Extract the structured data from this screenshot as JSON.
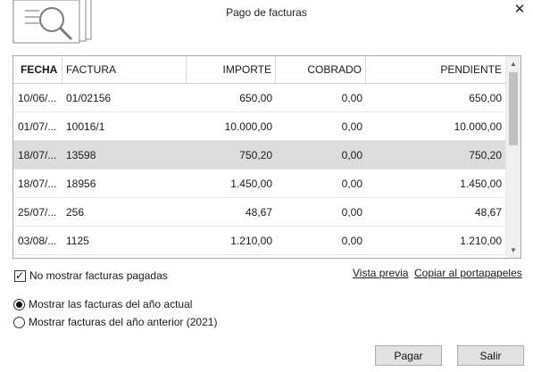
{
  "window": {
    "title": "Pago de facturas"
  },
  "table": {
    "columns": [
      "FECHA",
      "FACTURA",
      "IMPORTE",
      "COBRADO",
      "PENDIENTE"
    ],
    "rows": [
      [
        "10/06/...",
        "01/02156",
        "650,00",
        "0,00",
        "650,00"
      ],
      [
        "01/07/...",
        "10016/1",
        "10.000,00",
        "0,00",
        "10.000,00"
      ],
      [
        "18/07/...",
        "13598",
        "750,20",
        "0,00",
        "750,20"
      ],
      [
        "18/07/...",
        "18956",
        "1.450,00",
        "0,00",
        "1.450,00"
      ],
      [
        "25/07/...",
        "256",
        "48,67",
        "0,00",
        "48,67"
      ],
      [
        "03/08/...",
        "1125",
        "1.210,00",
        "0,00",
        "1.210,00"
      ]
    ],
    "selected_row": 2
  },
  "options": {
    "hide_paid_label": "No mostrar facturas pagadas",
    "hide_paid_checked": true,
    "preview_link": "Vista previa",
    "copy_link": "Copiar al portapapeles",
    "radio_current_year": "Mostrar las facturas del año actual",
    "radio_previous_year": "Mostrar facturas del año anterior (2021)",
    "selected_radio": "current_year"
  },
  "buttons": {
    "pay": "Pagar",
    "exit": "Salir"
  },
  "icons": {
    "header": "document-search-icon",
    "close": "close-icon"
  }
}
